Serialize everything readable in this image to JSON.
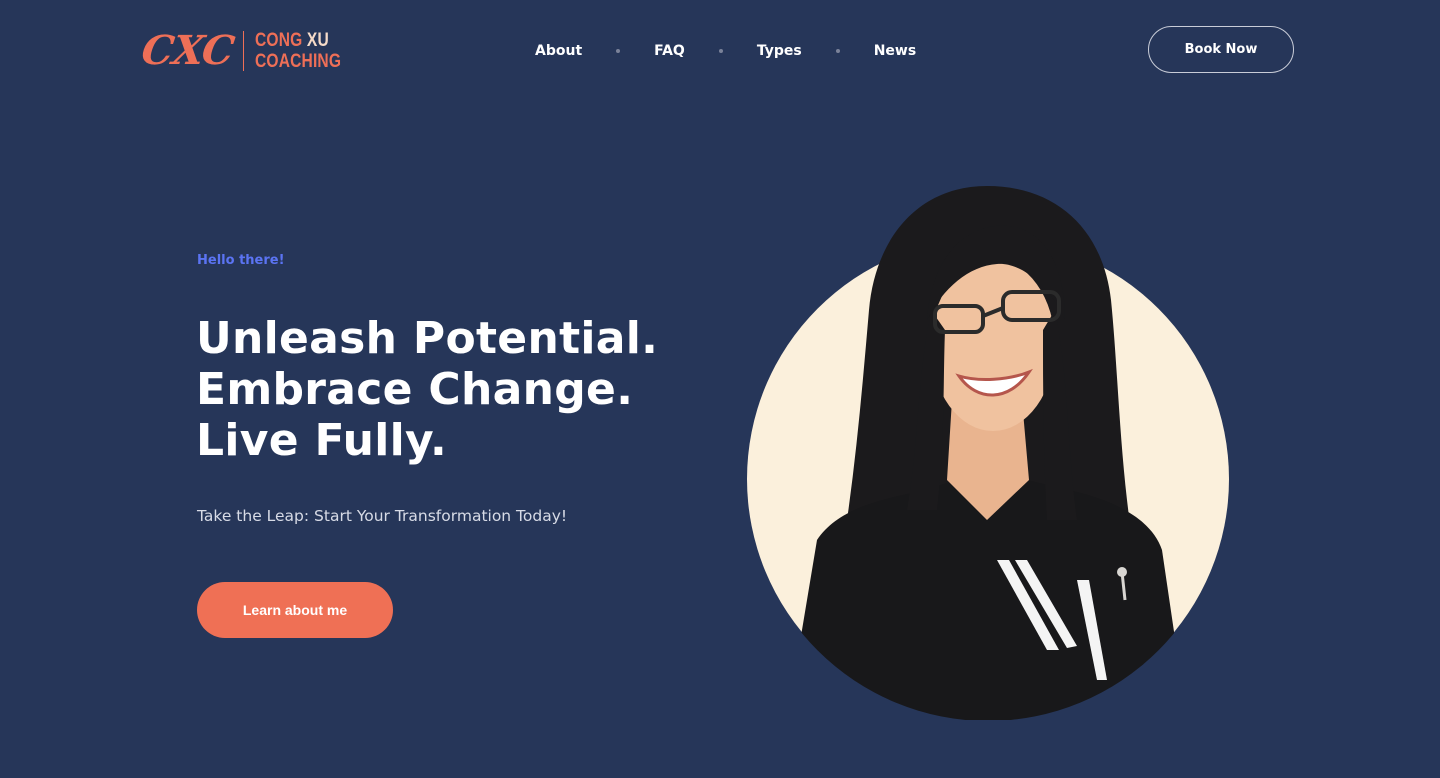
{
  "brand": {
    "mark": "CXC",
    "name_line1_a": "CONG",
    "name_line1_b": "XU",
    "name_line2": "COACHING",
    "colors": {
      "accent": "#ee6f57",
      "background": "#263659",
      "eyebrow": "#5b74f3",
      "portrait_bg": "#fbf0dc"
    }
  },
  "nav": {
    "items": [
      {
        "label": "About"
      },
      {
        "label": "FAQ"
      },
      {
        "label": "Types"
      },
      {
        "label": "News"
      }
    ],
    "book_label": "Book Now"
  },
  "hero": {
    "eyebrow": "Hello there!",
    "headline": [
      "Unleash Potential.",
      "Embrace Change.",
      "Live Fully."
    ],
    "subtext": "Take the Leap: Start Your Transformation Today!",
    "cta_label": "Learn about me"
  }
}
